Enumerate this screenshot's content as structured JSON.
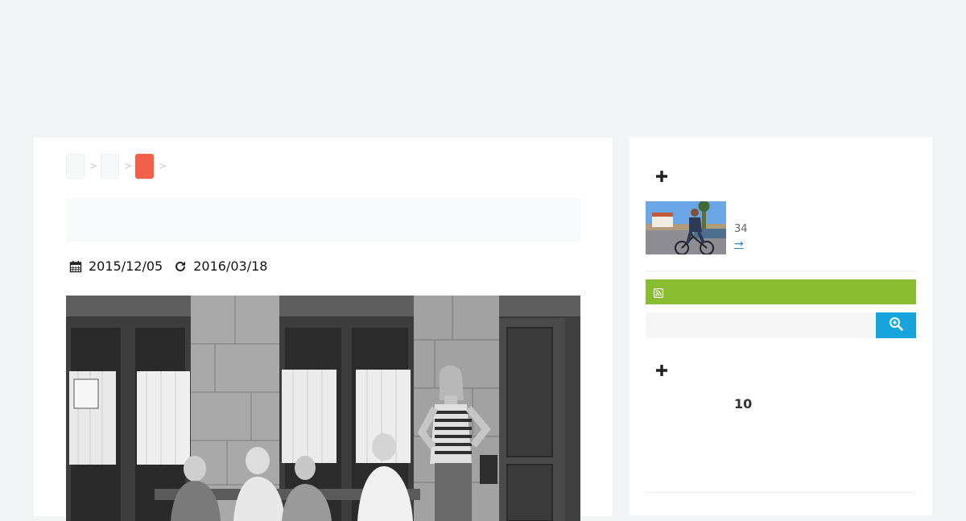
{
  "breadcrumb": {
    "separators": [
      ">",
      ">",
      ">"
    ]
  },
  "post_meta": {
    "published_date": "2015/12/05",
    "updated_date": "2016/03/18"
  },
  "sidebar": {
    "widget_1": {
      "view_count": "34",
      "link_arrow": "→"
    },
    "search": {
      "value": ""
    },
    "widget_2": {
      "count": "10"
    }
  },
  "colors": {
    "breadcrumb_active": "#f2604a",
    "rss_bar": "#8bbd32",
    "search_button": "#17a4dc",
    "link": "#2a86d6",
    "page_bg": "#f3f4f6"
  },
  "icons": {
    "published": "calendar-icon",
    "updated": "refresh-icon",
    "widget_header": "plus-icon",
    "rss": "rss-icon",
    "search": "zoom-in-icon"
  }
}
